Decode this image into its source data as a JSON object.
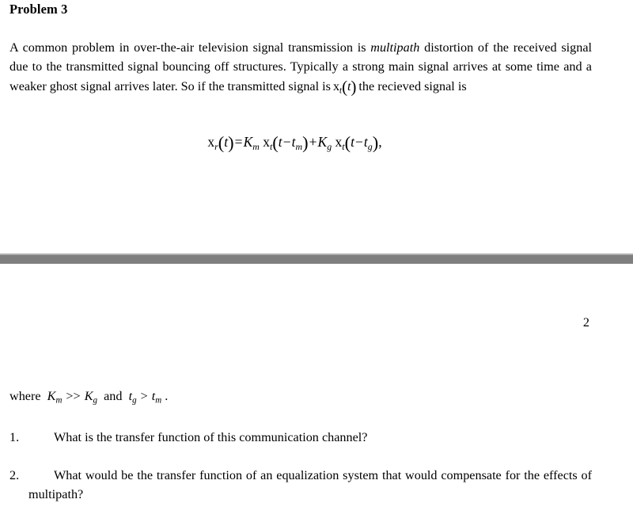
{
  "document": {
    "heading": "Problem 3",
    "paragraph": {
      "line1_a": "A common problem in over-the-air television signal transmission is ",
      "emphasis": "multipath",
      "line1_b": " distortion of the received signal due to the transmitted signal bouncing off structures. Typically a strong main signal arrives at some time and a weaker ghost signal arrives later.  So if the transmitted signal is",
      "inline_math": {
        "fn": "x",
        "sub": "t",
        "open": "(",
        "var": "t",
        "close": ")"
      },
      "line1_c": "the recieved signal is"
    },
    "equation": {
      "lhs_fn": "x",
      "lhs_sub": "r",
      "lhs_open": "(",
      "lhs_var": "t",
      "lhs_close": ")",
      "equals": "=",
      "term1_coef": "K",
      "term1_coef_sub": "m",
      "term1_fn": "x",
      "term1_fn_sub": "t",
      "term1_open": "(",
      "term1_var": "t",
      "term1_minus": "−",
      "term1_delay": "t",
      "term1_delay_sub": "m",
      "term1_close": ")",
      "plus": "+",
      "term2_coef": "K",
      "term2_coef_sub": "g",
      "term2_fn": "x",
      "term2_fn_sub": "t",
      "term2_open": "(",
      "term2_var": "t",
      "term2_minus": "−",
      "term2_delay": "t",
      "term2_delay_sub": "g",
      "term2_close": ")",
      "comma": ","
    },
    "page_number": "2",
    "where_line": {
      "where": "where",
      "k_main": "K",
      "k_main_sub": "m",
      "much_greater": ">>",
      "k_ghost": "K",
      "k_ghost_sub": "g",
      "and": "and",
      "t_ghost": "t",
      "t_ghost_sub": "g",
      "greater": ">",
      "t_main": "t",
      "t_main_sub": "m",
      "period": "."
    },
    "questions": [
      {
        "number": "1.",
        "text": "What is the transfer function of this communication channel?"
      },
      {
        "number": "2.",
        "text": "What would be the transfer function of an equalization system that would compensate for the effects of multipath?"
      }
    ]
  },
  "style": {
    "page_background": "#ffffff",
    "text_color": "#000000",
    "separator_color": "#7f7f7f",
    "separator_highlight": "#b0b0b0"
  }
}
